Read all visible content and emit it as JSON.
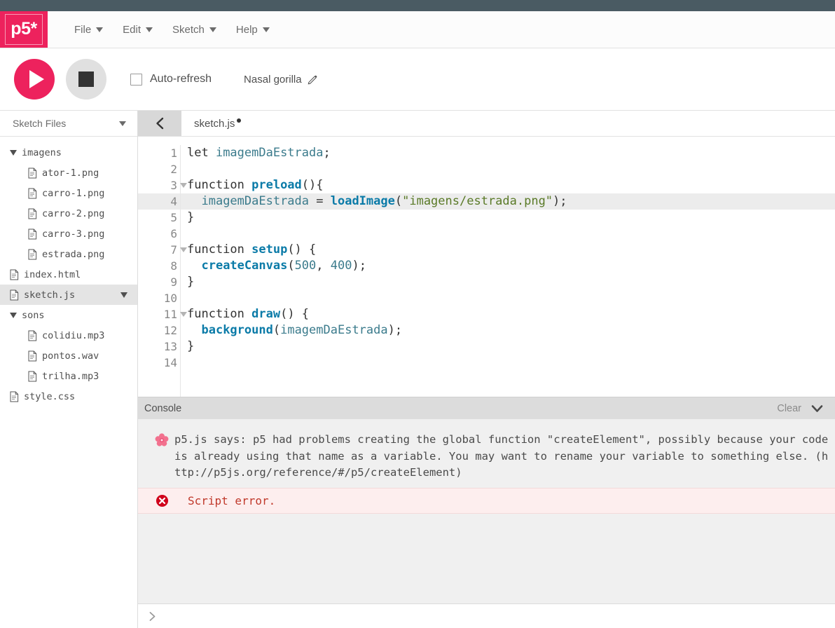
{
  "brand": {
    "logo_text": "p5*",
    "accent_color": "#ed225d",
    "topbar_color": "#4a5b63"
  },
  "menubar": {
    "items": [
      {
        "label": "File",
        "icon": "chevron-down-icon"
      },
      {
        "label": "Edit",
        "icon": "chevron-down-icon"
      },
      {
        "label": "Sketch",
        "icon": "chevron-down-icon"
      },
      {
        "label": "Help",
        "icon": "chevron-down-icon"
      }
    ]
  },
  "toolbar": {
    "play_icon": "play-icon",
    "stop_icon": "stop-icon",
    "autorefresh_label": "Auto-refresh",
    "autorefresh_checked": false,
    "sketch_name": "Nasal gorilla",
    "rename_icon": "pencil-icon"
  },
  "sidebar": {
    "title": "Sketch Files",
    "collapse_icon": "chevron-down-icon",
    "files": [
      {
        "label": "imagens",
        "type": "folder",
        "depth": 0,
        "selected": false,
        "expanded": true
      },
      {
        "label": "ator-1.png",
        "type": "file",
        "depth": 1,
        "selected": false
      },
      {
        "label": "carro-1.png",
        "type": "file",
        "depth": 1,
        "selected": false
      },
      {
        "label": "carro-2.png",
        "type": "file",
        "depth": 1,
        "selected": false
      },
      {
        "label": "carro-3.png",
        "type": "file",
        "depth": 1,
        "selected": false
      },
      {
        "label": "estrada.png",
        "type": "file",
        "depth": 1,
        "selected": false
      },
      {
        "label": "index.html",
        "type": "file",
        "depth": 0,
        "selected": false
      },
      {
        "label": "sketch.js",
        "type": "file",
        "depth": 0,
        "selected": true
      },
      {
        "label": "sons",
        "type": "folder",
        "depth": 0,
        "selected": false,
        "expanded": true
      },
      {
        "label": "colidiu.mp3",
        "type": "file",
        "depth": 1,
        "selected": false
      },
      {
        "label": "pontos.wav",
        "type": "file",
        "depth": 1,
        "selected": false
      },
      {
        "label": "trilha.mp3",
        "type": "file",
        "depth": 1,
        "selected": false
      },
      {
        "label": "style.css",
        "type": "file",
        "depth": 0,
        "selected": false
      }
    ]
  },
  "tabbar": {
    "collapse_icon": "chevron-left-icon",
    "active_tab": "sketch.js",
    "unsaved": true
  },
  "editor": {
    "highlighted_line": 4,
    "fold_lines": [
      3,
      7,
      11
    ],
    "lines": [
      {
        "n": 1,
        "tokens": [
          {
            "t": "kw",
            "v": "let "
          },
          {
            "t": "var",
            "v": "imagemDaEstrada"
          },
          {
            "t": "punct",
            "v": ";"
          }
        ]
      },
      {
        "n": 2,
        "tokens": []
      },
      {
        "n": 3,
        "tokens": [
          {
            "t": "kw",
            "v": "function "
          },
          {
            "t": "fn",
            "v": "preload"
          },
          {
            "t": "punct",
            "v": "(){"
          }
        ]
      },
      {
        "n": 4,
        "tokens": [
          {
            "t": "kw",
            "v": "  "
          },
          {
            "t": "var",
            "v": "imagemDaEstrada"
          },
          {
            "t": "punct",
            "v": " = "
          },
          {
            "t": "fn",
            "v": "loadImage"
          },
          {
            "t": "punct",
            "v": "("
          },
          {
            "t": "str",
            "v": "\"imagens/estrada.png\""
          },
          {
            "t": "punct",
            "v": ");"
          }
        ]
      },
      {
        "n": 5,
        "tokens": [
          {
            "t": "punct",
            "v": "}"
          }
        ]
      },
      {
        "n": 6,
        "tokens": []
      },
      {
        "n": 7,
        "tokens": [
          {
            "t": "kw",
            "v": "function "
          },
          {
            "t": "fn",
            "v": "setup"
          },
          {
            "t": "punct",
            "v": "() {"
          }
        ]
      },
      {
        "n": 8,
        "tokens": [
          {
            "t": "kw",
            "v": "  "
          },
          {
            "t": "fn",
            "v": "createCanvas"
          },
          {
            "t": "punct",
            "v": "("
          },
          {
            "t": "num",
            "v": "500"
          },
          {
            "t": "punct",
            "v": ", "
          },
          {
            "t": "num",
            "v": "400"
          },
          {
            "t": "punct",
            "v": ");"
          }
        ]
      },
      {
        "n": 9,
        "tokens": [
          {
            "t": "punct",
            "v": "}"
          }
        ]
      },
      {
        "n": 10,
        "tokens": []
      },
      {
        "n": 11,
        "tokens": [
          {
            "t": "kw",
            "v": "function "
          },
          {
            "t": "fn",
            "v": "draw"
          },
          {
            "t": "punct",
            "v": "() {"
          }
        ]
      },
      {
        "n": 12,
        "tokens": [
          {
            "t": "kw",
            "v": "  "
          },
          {
            "t": "fn",
            "v": "background"
          },
          {
            "t": "punct",
            "v": "("
          },
          {
            "t": "var",
            "v": "imagemDaEstrada"
          },
          {
            "t": "punct",
            "v": ");"
          }
        ]
      },
      {
        "n": 13,
        "tokens": [
          {
            "t": "punct",
            "v": "}"
          }
        ]
      },
      {
        "n": 14,
        "tokens": []
      }
    ]
  },
  "console": {
    "title": "Console",
    "clear_label": "Clear",
    "collapse_icon": "chevron-down-icon",
    "messages": [
      {
        "icon": "flower-icon",
        "level": "info",
        "text": "p5.js says: p5 had problems creating the global function \"createElement\", possibly because your code is already using that name as a variable. You may want to rename your variable to something else. (http://p5js.org/reference/#/p5/createElement)"
      },
      {
        "icon": "error-circle-icon",
        "level": "error",
        "text": "Script error."
      }
    ],
    "prompt_icon": "chevron-right-icon",
    "prompt_value": ""
  }
}
